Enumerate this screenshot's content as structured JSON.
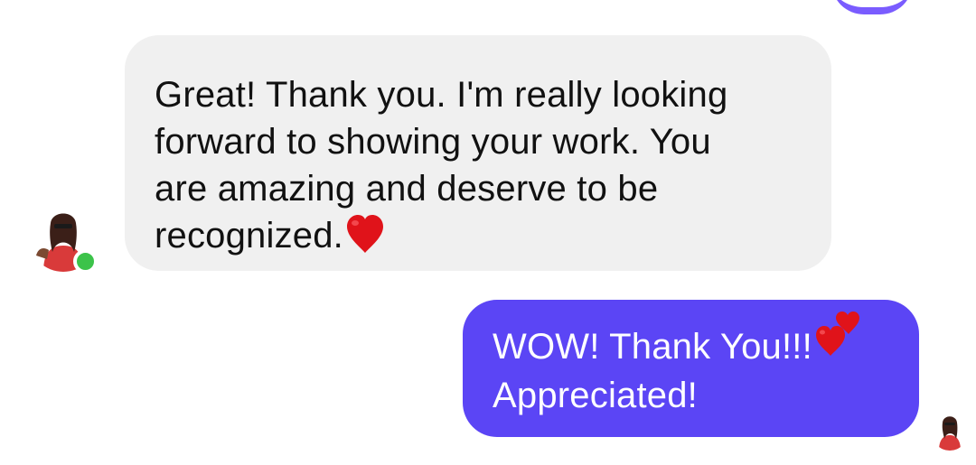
{
  "conversation": {
    "received_message": {
      "lines": [
        "Great! Thank you. I'm really looking",
        "forward to showing your work. You",
        "are amazing and deserve to be",
        "recognized."
      ],
      "trailing_emoji": "red-heart-icon"
    },
    "sent_message": {
      "lines": [
        "WOW! Thank You!!!",
        "Appreciated!"
      ],
      "emoji_after_first_line": "two-hearts-icon"
    },
    "contact_status": "online"
  },
  "colors": {
    "received_bubble": "#f0f0f0",
    "sent_bubble": "#5b45f5",
    "online_indicator": "#3cc34a",
    "heart": "#e0131a"
  }
}
